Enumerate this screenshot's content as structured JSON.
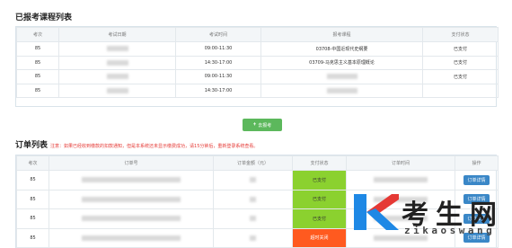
{
  "registered": {
    "title": "已报考课程列表",
    "columns": [
      "考次",
      "考试日期",
      "考试时间",
      "报考课程",
      "支付状态"
    ],
    "rows": [
      {
        "term": "85",
        "time": "09:00-11:30",
        "course": "03708-中国近现代史纲要",
        "status": "已支付"
      },
      {
        "term": "85",
        "time": "14:30-17:00",
        "course": "03709-马克思主义基本原理概论",
        "status": "已支付"
      },
      {
        "term": "85",
        "time": "09:00-11:30",
        "course": "",
        "status": "已支付"
      },
      {
        "term": "85",
        "time": "14:30-17:00",
        "course": "",
        "status": ""
      }
    ]
  },
  "add_button_label": "去报考",
  "orders": {
    "title": "订单列表",
    "notice": "注意：如果已经收到缴款的扣款通知，但是本系统还未显示缴费成功，请15分钟后，重新登录系统查看。",
    "columns": [
      "考次",
      "订单号",
      "订单金额（元）",
      "支付状态",
      "订单时间",
      "操作"
    ],
    "rows": [
      {
        "term": "85",
        "status": "已支付",
        "status_type": "paid",
        "action": "订单详情"
      },
      {
        "term": "85",
        "status": "已支付",
        "status_type": "paid",
        "action": "订单详情"
      },
      {
        "term": "85",
        "status": "已支付",
        "status_type": "paid",
        "action": "订单详情"
      },
      {
        "term": "85",
        "status": "超时关闭",
        "status_type": "closed",
        "action": "订单详情"
      }
    ]
  },
  "watermark": {
    "cn": "考生网",
    "en": "zikaoswang"
  },
  "colors": {
    "paid": "#8bd12f",
    "closed": "#ff5a1f",
    "add_button": "#5cb85c",
    "order_button": "#3a87c7",
    "notice": "#e53935"
  }
}
